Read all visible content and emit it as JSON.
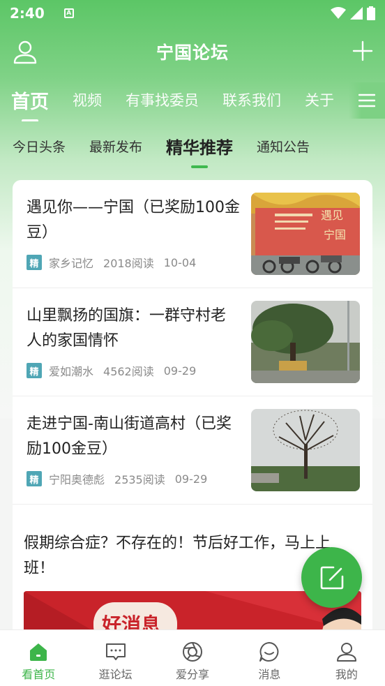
{
  "status_bar": {
    "time": "2:40"
  },
  "header": {
    "title": "宁国论坛"
  },
  "tabs": [
    {
      "label": "首页",
      "active": true
    },
    {
      "label": "视频",
      "active": false
    },
    {
      "label": "有事找委员",
      "active": false
    },
    {
      "label": "联系我们",
      "active": false
    },
    {
      "label": "关于",
      "active": false
    }
  ],
  "subtabs": [
    {
      "label": "今日头条",
      "active": false
    },
    {
      "label": "最新发布",
      "active": false
    },
    {
      "label": "精华推荐",
      "active": true
    },
    {
      "label": "通知公告",
      "active": false
    }
  ],
  "articles": [
    {
      "title": "遇见你——宁国（已奖励100金豆）",
      "badge": "精",
      "author": "家乡记忆",
      "reads": "2018阅读",
      "date": "10-04"
    },
    {
      "title": "山里飘扬的国旗：一群守村老人的家国情怀",
      "badge": "精",
      "author": "爱如潮水",
      "reads": "4562阅读",
      "date": "09-29"
    },
    {
      "title": "走进宁国-南山街道高村（已奖励100金豆）",
      "badge": "精",
      "author": "宁阳奥德彪",
      "reads": "2535阅读",
      "date": "09-29"
    }
  ],
  "featured": {
    "title": "假期综合症？不存在的！节后好工作，马上上班！",
    "banner_text": "好消息"
  },
  "bottom_nav": [
    {
      "label": "看首页",
      "icon": "home-icon",
      "active": true
    },
    {
      "label": "逛论坛",
      "icon": "chat-icon",
      "active": false
    },
    {
      "label": "爱分享",
      "icon": "share-icon",
      "active": false
    },
    {
      "label": "消息",
      "icon": "message-icon",
      "active": false
    },
    {
      "label": "我的",
      "icon": "profile-icon",
      "active": false
    }
  ],
  "colors": {
    "accent": "#3db54a",
    "header_green": "#5cc666",
    "badge": "#4fa6b5"
  }
}
